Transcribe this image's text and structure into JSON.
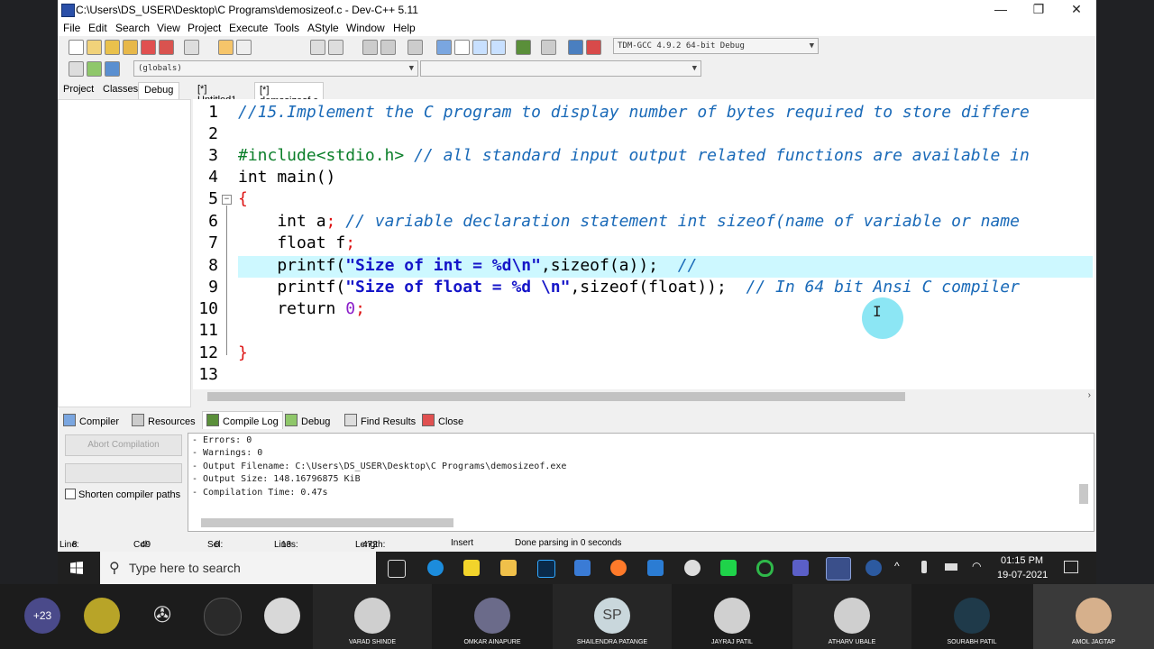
{
  "window": {
    "title": "C:\\Users\\DS_USER\\Desktop\\C Programs\\demosizeof.c - Dev-C++ 5.11",
    "controls": [
      "—",
      "❐",
      "✕"
    ]
  },
  "menu": [
    "File",
    "Edit",
    "Search",
    "View",
    "Project",
    "Execute",
    "Tools",
    "AStyle",
    "Window",
    "Help"
  ],
  "toolbar": {
    "compiler_select": "TDM-GCC 4.9.2 64-bit Debug",
    "scope_select": "(globals)"
  },
  "left_tabs": [
    "Project",
    "Classes",
    "Debug"
  ],
  "editor_tabs": [
    "[*] Untitled1",
    "[*] demosizeof.c"
  ],
  "editor": {
    "line_numbers": [
      "1",
      "2",
      "3",
      "4",
      "5",
      "6",
      "7",
      "8",
      "9",
      "10",
      "11",
      "12",
      "13"
    ],
    "lines": {
      "l1": "//15.Implement the C program to display number of bytes required to store differe",
      "l3a": "#include<stdio.h>",
      "l3b": " // all standard input output related functions are available in",
      "l4": "int main()",
      "l5": "{",
      "l6a": "    int a",
      "l6b": ";",
      "l6c": " // variable declaration statement int sizeof(name of variable or name",
      "l7a": "    float f",
      "l7b": ";",
      "l8a": "    printf(",
      "l8b": "\"Size of int = %d\\n\"",
      "l8c": ",sizeof(a));",
      "l8d": "  //",
      "l9a": "    printf(",
      "l9b": "\"Size of float = %d \\n\"",
      "l9c": ",sizeof(float));",
      "l9d": "  // In 64 bit Ansi C compiler",
      "l10a": "    return ",
      "l10b": "0",
      "l10c": ";",
      "l12": "}"
    }
  },
  "bottom_tabs": [
    "Compiler",
    "Resources",
    "Compile Log",
    "Debug",
    "Find Results",
    "Close"
  ],
  "compile": {
    "abort_label": "Abort Compilation",
    "shorten_label": "Shorten compiler paths",
    "log": [
      "- Errors: 0",
      "- Warnings: 0",
      "- Output Filename: C:\\Users\\DS_USER\\Desktop\\C Programs\\demosizeof.exe",
      "- Output Size: 148.16796875 KiB",
      "- Compilation Time: 0.47s"
    ]
  },
  "status": {
    "line_label": "Line:",
    "line": "8",
    "col_label": "Col:",
    "col": "49",
    "sel_label": "Sel:",
    "sel": "0",
    "lines_label": "Lines:",
    "lines": "13",
    "length_label": "Length:",
    "length": "472",
    "mode": "Insert",
    "message": "Done parsing in 0 seconds"
  },
  "taskbar": {
    "search_placeholder": "Type here to search",
    "time": "01:15 PM",
    "date": "19-07-2021"
  },
  "meeting": {
    "more_count": "+23",
    "sp_initials": "SP",
    "participants": [
      "VARAD SHINDE",
      "OMKAR AINAPURE",
      "SHAILENDRA PATANGE",
      "JAYRAJ PATIL",
      "ATHARV UBALE",
      "SOURABH PATIL",
      "AMOL JAGTAP"
    ]
  }
}
